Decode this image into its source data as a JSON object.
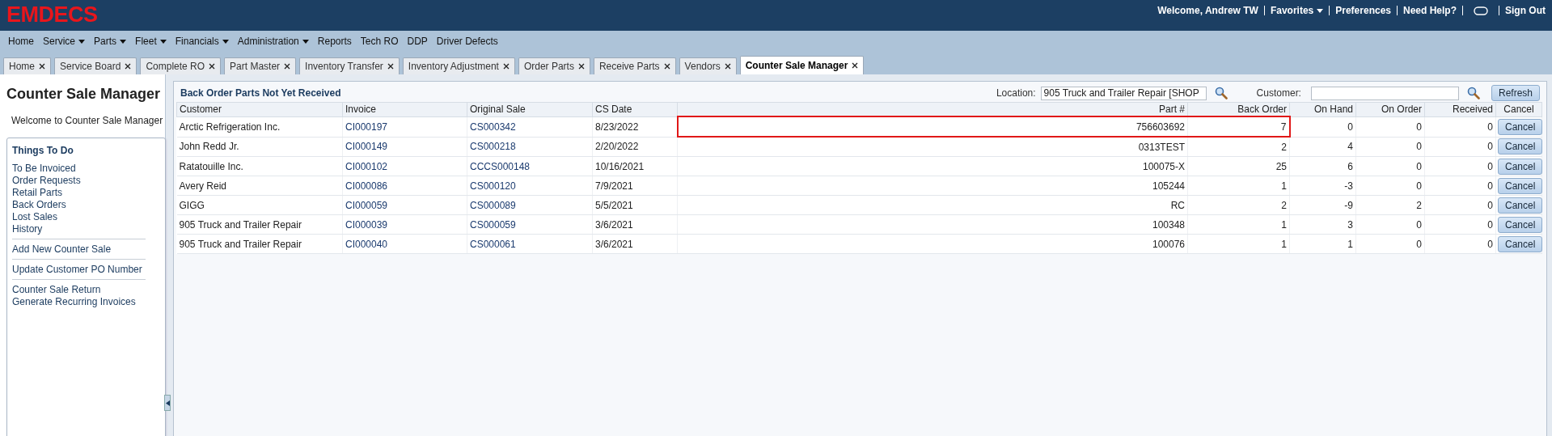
{
  "header": {
    "logo": "EMDECS",
    "welcome": "Welcome, Andrew TW",
    "links": [
      {
        "label": "Favorites",
        "dropdown": true
      },
      {
        "label": "Preferences",
        "dropdown": false
      },
      {
        "label": "Need Help?",
        "dropdown": false
      }
    ],
    "sign_out": "Sign Out"
  },
  "menu": [
    {
      "label": "Home",
      "dropdown": false
    },
    {
      "label": "Service",
      "dropdown": true
    },
    {
      "label": "Parts",
      "dropdown": true
    },
    {
      "label": "Fleet",
      "dropdown": true
    },
    {
      "label": "Financials",
      "dropdown": true
    },
    {
      "label": "Administration",
      "dropdown": true
    },
    {
      "label": "Reports",
      "dropdown": false
    },
    {
      "label": "Tech RO",
      "dropdown": false
    },
    {
      "label": "DDP",
      "dropdown": false
    },
    {
      "label": "Driver Defects",
      "dropdown": false
    }
  ],
  "tabs": [
    {
      "label": "Home",
      "selected": false
    },
    {
      "label": "Service Board",
      "selected": false
    },
    {
      "label": "Complete RO",
      "selected": false
    },
    {
      "label": "Part Master",
      "selected": false
    },
    {
      "label": "Inventory Transfer",
      "selected": false
    },
    {
      "label": "Inventory Adjustment",
      "selected": false
    },
    {
      "label": "Order Parts",
      "selected": false
    },
    {
      "label": "Receive Parts",
      "selected": false
    },
    {
      "label": "Vendors",
      "selected": false
    },
    {
      "label": "Counter Sale Manager",
      "selected": true
    }
  ],
  "sidebar": {
    "title": "Counter Sale Manager",
    "welcome": "Welcome to Counter Sale Manager",
    "box_title": "Things To Do",
    "groups": [
      [
        "To Be Invoiced",
        "Order Requests",
        "Retail Parts",
        "Back Orders",
        "Lost Sales",
        "History"
      ],
      [
        "Add New Counter Sale"
      ],
      [
        "Update Customer PO Number"
      ],
      [
        "Counter Sale Return",
        "Generate Recurring Invoices"
      ]
    ]
  },
  "panel": {
    "title": "Back Order Parts Not Yet Received",
    "location_label": "Location:",
    "location_value": "905 Truck and Trailer Repair [SHOP",
    "customer_label": "Customer:",
    "refresh": "Refresh"
  },
  "table": {
    "columns": [
      "Customer",
      "Invoice",
      "Original Sale",
      "CS Date",
      "Part #",
      "Back Order",
      "On Hand",
      "On Order",
      "Received",
      "Cancel"
    ],
    "rows": [
      {
        "customer": "Arctic Refrigeration Inc.",
        "invoice": "CI000197",
        "original_sale": "CS000342",
        "cs_date": "8/23/2022",
        "part": "756603692",
        "back_order": "7",
        "on_hand": "0",
        "on_order": "0",
        "received": "0",
        "action": "Cancel",
        "highlighted": true
      },
      {
        "customer": "John Redd Jr.",
        "invoice": "CI000149",
        "original_sale": "CS000218",
        "cs_date": "2/20/2022",
        "part": "0313TEST",
        "back_order": "2",
        "on_hand": "4",
        "on_order": "0",
        "received": "0",
        "action": "Cancel",
        "highlighted": false
      },
      {
        "customer": "Ratatouille Inc.",
        "invoice": "CI000102",
        "original_sale": "CCCS000148",
        "cs_date": "10/16/2021",
        "part": "100075-X",
        "back_order": "25",
        "on_hand": "6",
        "on_order": "0",
        "received": "0",
        "action": "Cancel",
        "highlighted": false
      },
      {
        "customer": "Avery Reid",
        "invoice": "CI000086",
        "original_sale": "CS000120",
        "cs_date": "7/9/2021",
        "part": "105244",
        "back_order": "1",
        "on_hand": "-3",
        "on_order": "0",
        "received": "0",
        "action": "Cancel",
        "highlighted": false
      },
      {
        "customer": "GIGG",
        "invoice": "CI000059",
        "original_sale": "CS000089",
        "cs_date": "5/5/2021",
        "part": "RC",
        "back_order": "2",
        "on_hand": "-9",
        "on_order": "2",
        "received": "0",
        "action": "Cancel",
        "highlighted": false
      },
      {
        "customer": "905 Truck and Trailer Repair",
        "invoice": "CI000039",
        "original_sale": "CS000059",
        "cs_date": "3/6/2021",
        "part": "100348",
        "back_order": "1",
        "on_hand": "3",
        "on_order": "0",
        "received": "0",
        "action": "Cancel",
        "highlighted": false
      },
      {
        "customer": "905 Truck and Trailer Repair",
        "invoice": "CI000040",
        "original_sale": "CS000061",
        "cs_date": "3/6/2021",
        "part": "100076",
        "back_order": "1",
        "on_hand": "1",
        "on_order": "0",
        "received": "0",
        "action": "Cancel",
        "highlighted": false
      }
    ]
  }
}
